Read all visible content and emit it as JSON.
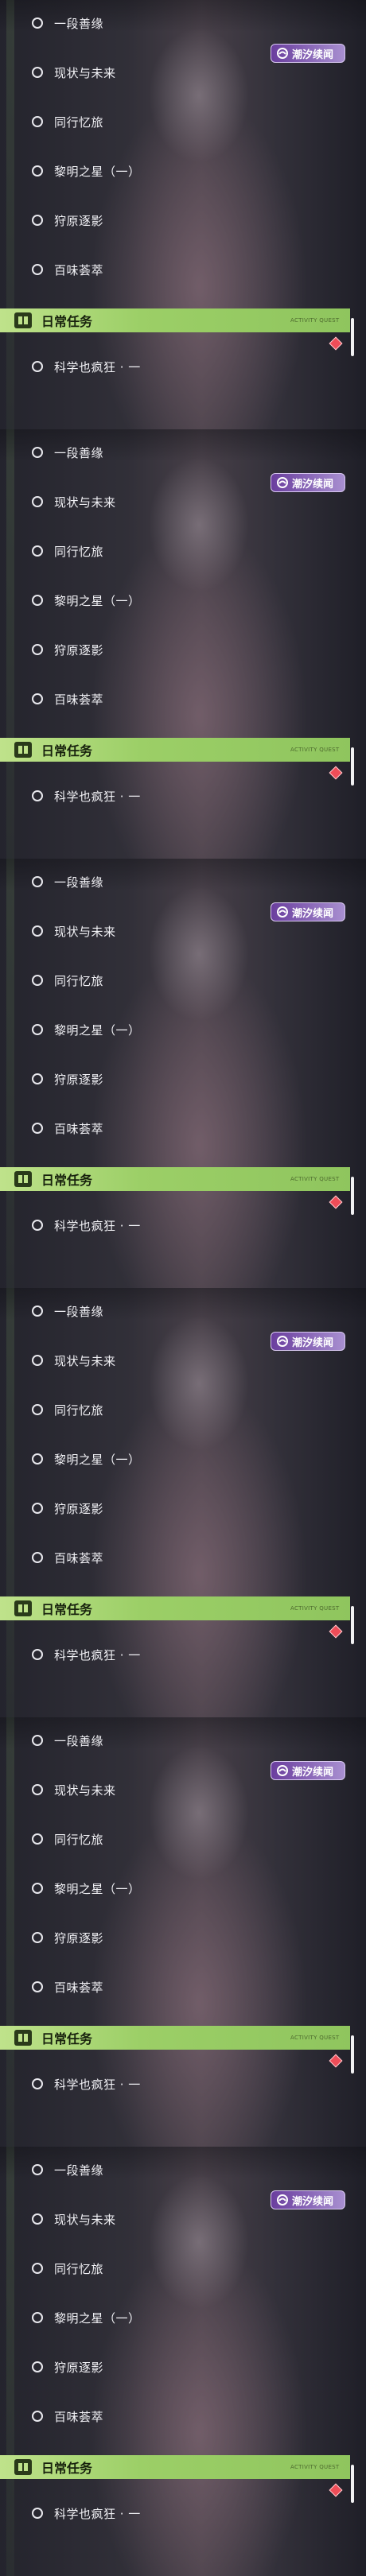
{
  "quests": [
    "一段善缘",
    "现状与未来",
    "同行忆旅",
    "黎明之星（一）",
    "狩原逐影",
    "百味荟萃"
  ],
  "tag": {
    "label": "潮汐续闻"
  },
  "section": {
    "title": "日常任务",
    "small_text": "ACTIVITY QUEST"
  },
  "daily": [
    "科学也疯狂 · 一"
  ],
  "panel_count": 6,
  "colors": {
    "header": "#9ccf67",
    "tag": "#6a3e9e",
    "alert": "#ee4d58"
  },
  "icons": {
    "item": "circle-icon",
    "header": "book-icon",
    "tag": "tidal-icon",
    "alert": "diamond-icon"
  }
}
